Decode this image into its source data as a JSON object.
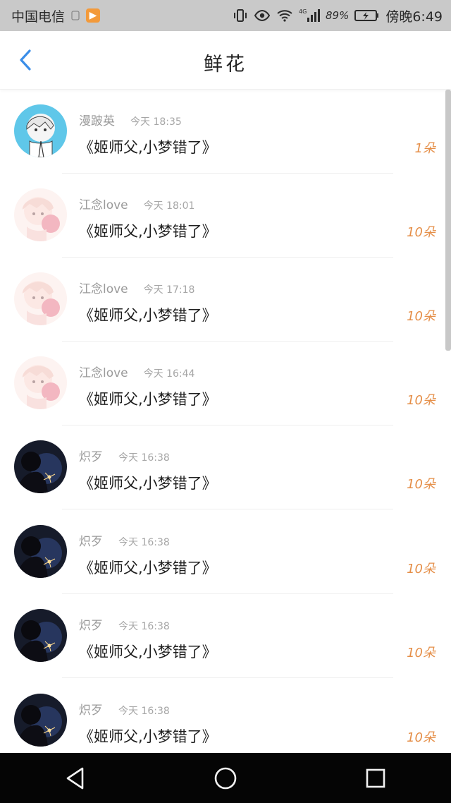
{
  "status_bar": {
    "carrier": "中国电信",
    "battery_percent": "89%",
    "network": "4G",
    "time_label": "傍晚6:49",
    "icons": [
      "vibrate-icon",
      "eye-icon",
      "wifi-icon",
      "signal-icon",
      "battery-icon"
    ]
  },
  "header": {
    "title": "鲜花"
  },
  "list": {
    "items": [
      {
        "name": "漫跛英",
        "time": "今天 18:35",
        "message": "《姬师父,小梦错了》",
        "count": "1朵",
        "avatar": "avatar-anime-white"
      },
      {
        "name": "江念love",
        "time": "今天 18:01",
        "message": "《姬师父,小梦错了》",
        "count": "10朵",
        "avatar": "avatar-pink-girl"
      },
      {
        "name": "江念love",
        "time": "今天 17:18",
        "message": "《姬师父,小梦错了》",
        "count": "10朵",
        "avatar": "avatar-pink-girl"
      },
      {
        "name": "江念love",
        "time": "今天 16:44",
        "message": "《姬师父,小梦错了》",
        "count": "10朵",
        "avatar": "avatar-pink-girl"
      },
      {
        "name": "炽歹",
        "time": "今天 16:38",
        "message": "《姬师父,小梦错了》",
        "count": "10朵",
        "avatar": "avatar-dark-sparkler"
      },
      {
        "name": "炽歹",
        "time": "今天 16:38",
        "message": "《姬师父,小梦错了》",
        "count": "10朵",
        "avatar": "avatar-dark-sparkler"
      },
      {
        "name": "炽歹",
        "time": "今天 16:38",
        "message": "《姬师父,小梦错了》",
        "count": "10朵",
        "avatar": "avatar-dark-sparkler"
      },
      {
        "name": "炽歹",
        "time": "今天 16:38",
        "message": "《姬师父,小梦错了》",
        "count": "10朵",
        "avatar": "avatar-dark-sparkler"
      }
    ]
  },
  "colors": {
    "accent": "#3b8ee8",
    "count": "#e58f49",
    "status_bar_bg": "#c9c9c9",
    "nav_bottom_bg": "#050505"
  },
  "bottom_nav": {
    "icons": [
      "back-triangle-icon",
      "home-circle-icon",
      "recent-square-icon"
    ]
  }
}
